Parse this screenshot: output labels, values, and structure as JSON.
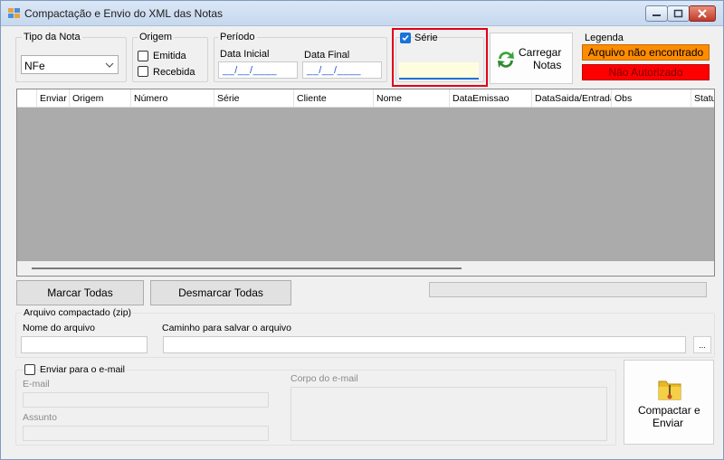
{
  "window": {
    "title": "Compactação e Envio do XML das Notas"
  },
  "filters": {
    "tipo_nota_label": "Tipo da Nota",
    "tipo_nota_value": "NFe",
    "origem_label": "Origem",
    "origem_options": [
      "Emitida",
      "Recebida"
    ],
    "periodo_label": "Período",
    "data_inicial_label": "Data Inicial",
    "data_inicial_value": "__/__/____",
    "data_final_label": "Data Final",
    "data_final_value": "__/__/____",
    "serie_label": "Série",
    "serie_checked": true,
    "serie_value": ""
  },
  "carregar": {
    "label_line1": "Carregar",
    "label_line2": "Notas"
  },
  "legend": {
    "title": "Legenda",
    "items": [
      {
        "label": "Arquivo não encontrado",
        "color": "#ff8c00"
      },
      {
        "label": "Não Autorizado",
        "color": "#ff0000"
      }
    ]
  },
  "grid": {
    "columns": [
      "Enviar",
      "Origem",
      "Número",
      "Série",
      "Cliente",
      "Nome",
      "DataEmissao",
      "DataSaida/Entrada",
      "Obs",
      "Status"
    ]
  },
  "actions": {
    "marcar_todas": "Marcar Todas",
    "desmarcar_todas": "Desmarcar Todas"
  },
  "zip": {
    "group_label": "Arquivo compactado (zip)",
    "nome_label": "Nome do arquivo",
    "nome_value": "",
    "caminho_label": "Caminho para salvar o arquivo",
    "caminho_value": "",
    "browse_label": "..."
  },
  "email": {
    "enviar_label": "Enviar para o e-mail",
    "email_label": "E-mail",
    "assunto_label": "Assunto",
    "corpo_label": "Corpo do e-mail"
  },
  "compactar": {
    "label_line1": "Compactar e",
    "label_line2": "Enviar"
  },
  "colors": {
    "accent_blue": "#1a73d9",
    "highlight_red": "#e0001b",
    "serie_field_bg": "#fffde0"
  }
}
